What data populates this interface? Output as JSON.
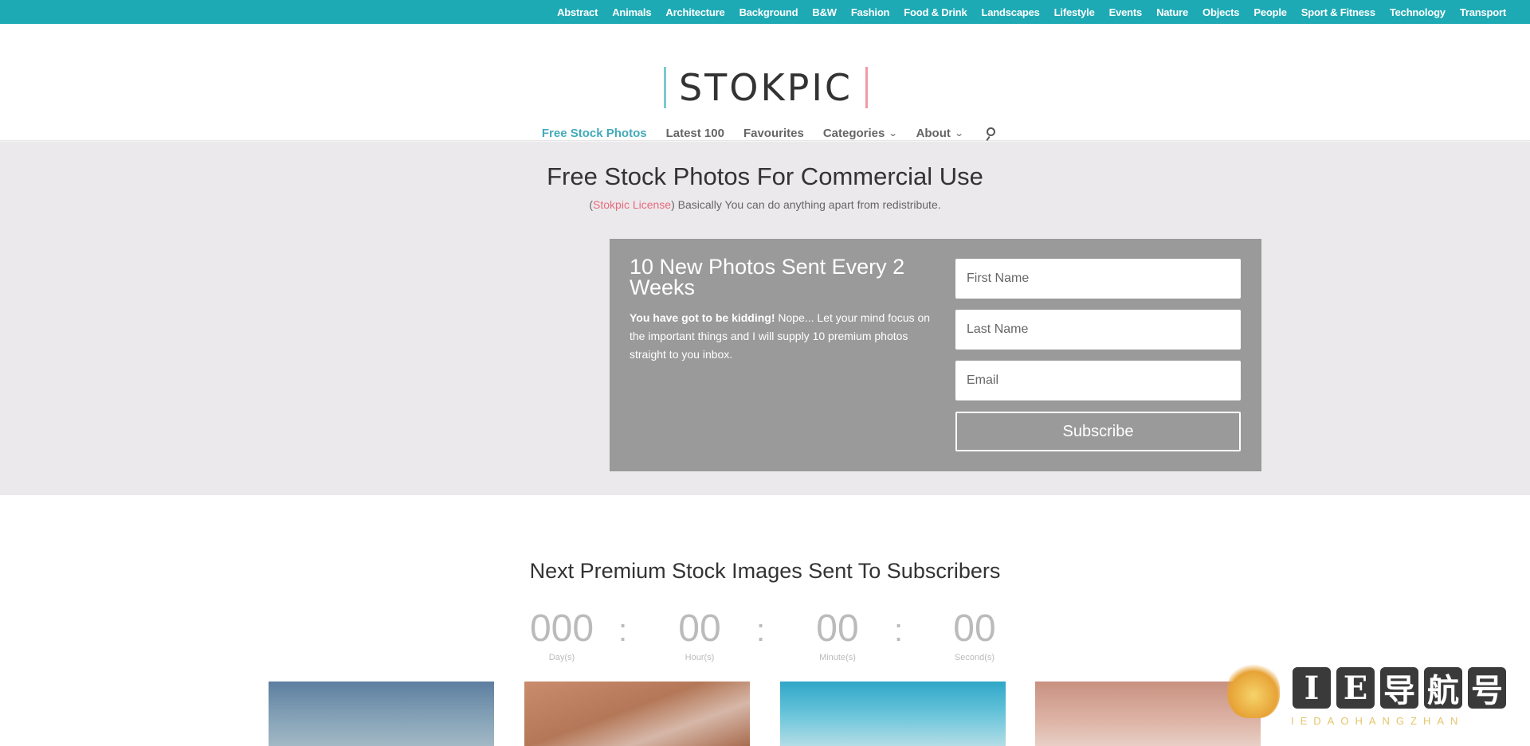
{
  "top_categories": [
    "Abstract",
    "Animals",
    "Architecture",
    "Background",
    "B&W",
    "Fashion",
    "Food & Drink",
    "Landscapes",
    "Lifestyle",
    "Events",
    "Nature",
    "Objects",
    "People",
    "Sport & Fitness",
    "Technology",
    "Transport"
  ],
  "logo": {
    "text": "STOKPIC"
  },
  "nav": {
    "items": [
      {
        "label": "Free Stock Photos",
        "active": true
      },
      {
        "label": "Latest 100"
      },
      {
        "label": "Favourites"
      },
      {
        "label": "Categories",
        "dropdown": true
      },
      {
        "label": "About",
        "dropdown": true
      }
    ],
    "search_icon": "search-icon"
  },
  "hero": {
    "title": "Free Stock Photos For Commercial Use",
    "sub_open": "(",
    "license_link": "Stokpic License",
    "sub_rest": ") Basically You can do anything apart from redistribute."
  },
  "signup": {
    "title": "10 New Photos Sent Every 2 Weeks",
    "desc_bold": "You have got to be kidding!",
    "desc_rest": " Nope... Let your mind focus on the important things and I will supply 10 premium photos straight to you inbox.",
    "first_name_placeholder": "First Name",
    "last_name_placeholder": "Last Name",
    "email_placeholder": "Email",
    "button": "Subscribe"
  },
  "countdown": {
    "title": "Next Premium Stock Images Sent To Subscribers",
    "days": "000",
    "days_label": "Day(s)",
    "hours": "00",
    "hours_label": "Hour(s)",
    "minutes": "00",
    "minutes_label": "Minute(s)",
    "seconds": "00",
    "seconds_label": "Second(s)",
    "separator": ":"
  },
  "watermark": {
    "chars": [
      "I",
      "E",
      "导",
      "航",
      "号"
    ],
    "sub": "IEDAOHANGZHAN"
  },
  "colors": {
    "topbar": "#1eaab5",
    "active_nav": "#2ea3b3",
    "license": "#e86a7d",
    "signup_bg": "#9a9a9a",
    "hero_bg": "#ebe9eb"
  }
}
